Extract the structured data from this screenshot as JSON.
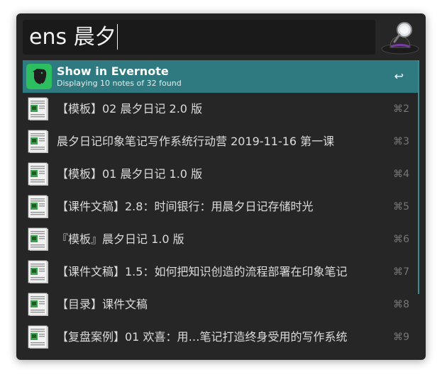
{
  "search": {
    "query": "ens 晨夕"
  },
  "selected_item": {
    "title": "Show in Evernote",
    "subtitle": "Displaying 10 notes of 32 found",
    "shortcut": "↩",
    "icon": "evernote-elephant-icon"
  },
  "results": [
    {
      "title": "【模板】02 晨夕日记 2.0 版",
      "shortcut": "⌘2",
      "icon": "note-document-icon"
    },
    {
      "title": "晨夕日记印象笔记写作系统行动营 2019-11-16 第一课",
      "shortcut": "⌘3",
      "icon": "note-document-icon"
    },
    {
      "title": "【模板】01 晨夕日记 1.0 版",
      "shortcut": "⌘4",
      "icon": "note-document-icon"
    },
    {
      "title": "【课件文稿】2.8：时间银行：用晨夕日记存储时光",
      "shortcut": "⌘5",
      "icon": "note-document-icon"
    },
    {
      "title": "『模板』晨夕日记 1.0 版",
      "shortcut": "⌘6",
      "icon": "note-document-icon"
    },
    {
      "title": "【课件文稿】1.5：如何把知识创造的流程部署在印象笔记",
      "shortcut": "⌘7",
      "icon": "note-document-icon"
    },
    {
      "title": "【目录】课件文稿",
      "shortcut": "⌘8",
      "icon": "note-document-icon"
    },
    {
      "title": "【复盘案例】01 欢喜：用…笔记打造终身受用的写作系统",
      "shortcut": "⌘9",
      "icon": "note-document-icon"
    }
  ],
  "colors": {
    "window_bg": "#262626",
    "selection_bg": "#2f7a80",
    "evernote_green": "#2dbe60"
  }
}
